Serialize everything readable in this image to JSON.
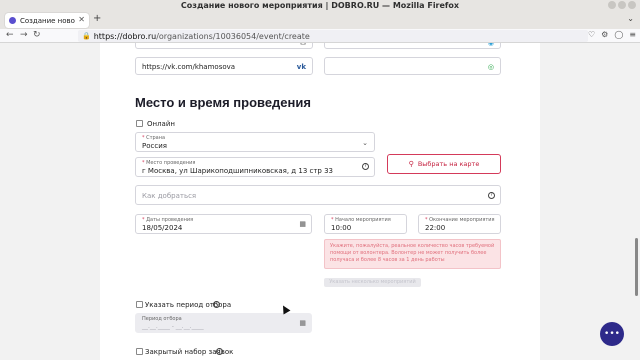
{
  "window": {
    "title": "Создание нового мероприятия | DOBRO.RU — Mozilla Firefox"
  },
  "tab": {
    "label": "Создание нового"
  },
  "urlbar": {
    "url_host": "https://dobro.ru",
    "url_path": "/organizations/10036054/event/create"
  },
  "contacts": {
    "vk_value": "https://vk.com/khamosova"
  },
  "section": {
    "title": "Место и время проведения"
  },
  "online": {
    "label": "Онлайн"
  },
  "country": {
    "label": "Страна",
    "value": "Россия"
  },
  "place": {
    "label": "Место проведения",
    "value": "г Москва, ул Шарикоподшипниковская, д 13 стр 33"
  },
  "map_button": {
    "label": "Выбрать на карте"
  },
  "directions": {
    "placeholder": "Как добраться"
  },
  "dates": {
    "label": "Даты проведения",
    "value": "18/05/2024"
  },
  "start_time": {
    "label": "Начало мероприятия",
    "value": "10:00"
  },
  "end_time": {
    "label": "Окончание мероприятия",
    "value": "22:00"
  },
  "error": {
    "line1": "Укажите, пожалуйста, реальное количество часов требуемой",
    "line2": "помощи от волонтера. Волонтер не может получить более",
    "line3": "получаса и более 8 часов за 1 день работы"
  },
  "add_button": {
    "label": "Указать несколько мероприятий"
  },
  "selection_period": {
    "label": "Указать период отбора",
    "field_label": "Период отбора",
    "placeholder": "__.__.____ - __.__.____"
  },
  "closed_recruitment": {
    "label": "Закрытый набор заявок"
  },
  "colors": {
    "accent": "#d43a5a",
    "chat": "#2e2a8a",
    "error_bg": "#fbe3e5"
  }
}
